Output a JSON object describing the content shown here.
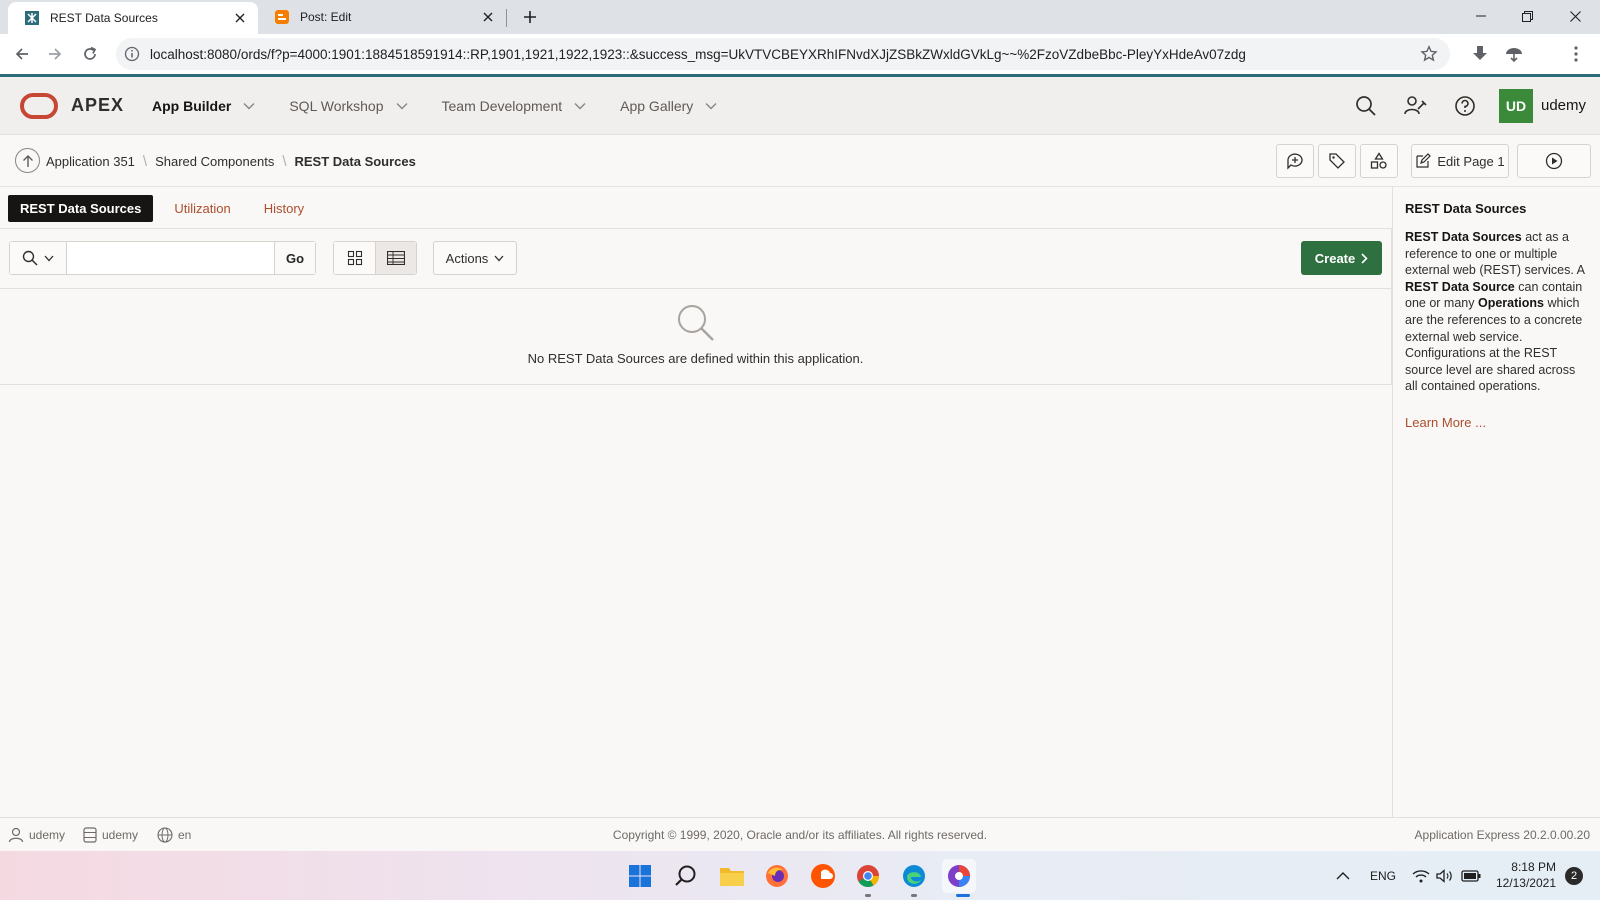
{
  "browser": {
    "tabs": [
      {
        "title": "REST Data Sources"
      },
      {
        "title": "Post: Edit"
      }
    ],
    "url": "localhost:8080/ords/f?p=4000:1901:1884518591914::RP,1901,1921,1922,1923::&success_msg=UkVTVCBEYXRhIFNvdXJjZSBkZWxldGVkLg~~%2FzoVZdbeBbc-PleyYxHdeAv07zdg"
  },
  "apex": {
    "brand": "APEX",
    "menu": [
      {
        "label": "App Builder"
      },
      {
        "label": "SQL Workshop"
      },
      {
        "label": "Team Development"
      },
      {
        "label": "App Gallery"
      }
    ],
    "user_initials": "UD",
    "user_name": "udemy"
  },
  "breadcrumb": {
    "items": [
      "Application 351",
      "Shared Components",
      "REST Data Sources"
    ],
    "edit_page_label": "Edit Page 1"
  },
  "page": {
    "tabs": [
      "REST Data Sources",
      "Utilization",
      "History"
    ],
    "search_value": "",
    "go_label": "Go",
    "actions_label": "Actions",
    "create_label": "Create",
    "empty_message": "No REST Data Sources are defined within this application."
  },
  "help": {
    "title": "REST Data Sources",
    "t1": "REST Data Sources",
    "t2": " act as a reference to one or multiple external web (REST) services. A ",
    "t3": "REST Data Source",
    "t4": " can contain one or many ",
    "t5": "Operations",
    "t6": " which are the references to a concrete external web service. Configurations at the REST source level are shared across all contained operations.",
    "learn_more": "Learn More ..."
  },
  "footer": {
    "user": "udemy",
    "workspace": "udemy",
    "language": "en",
    "copyright": "Copyright © 1999, 2020, Oracle and/or its affiliates. All rights reserved.",
    "version": "Application Express 20.2.0.00.20"
  },
  "taskbar": {
    "language": "ENG",
    "time": "8:18 PM",
    "date": "12/13/2021",
    "notifications": "2"
  },
  "colors": {
    "oracle_red": "#c74634",
    "create_green": "#2f7041",
    "link_orange": "#ac4e2c",
    "user_badge": "#3a8a3a"
  }
}
